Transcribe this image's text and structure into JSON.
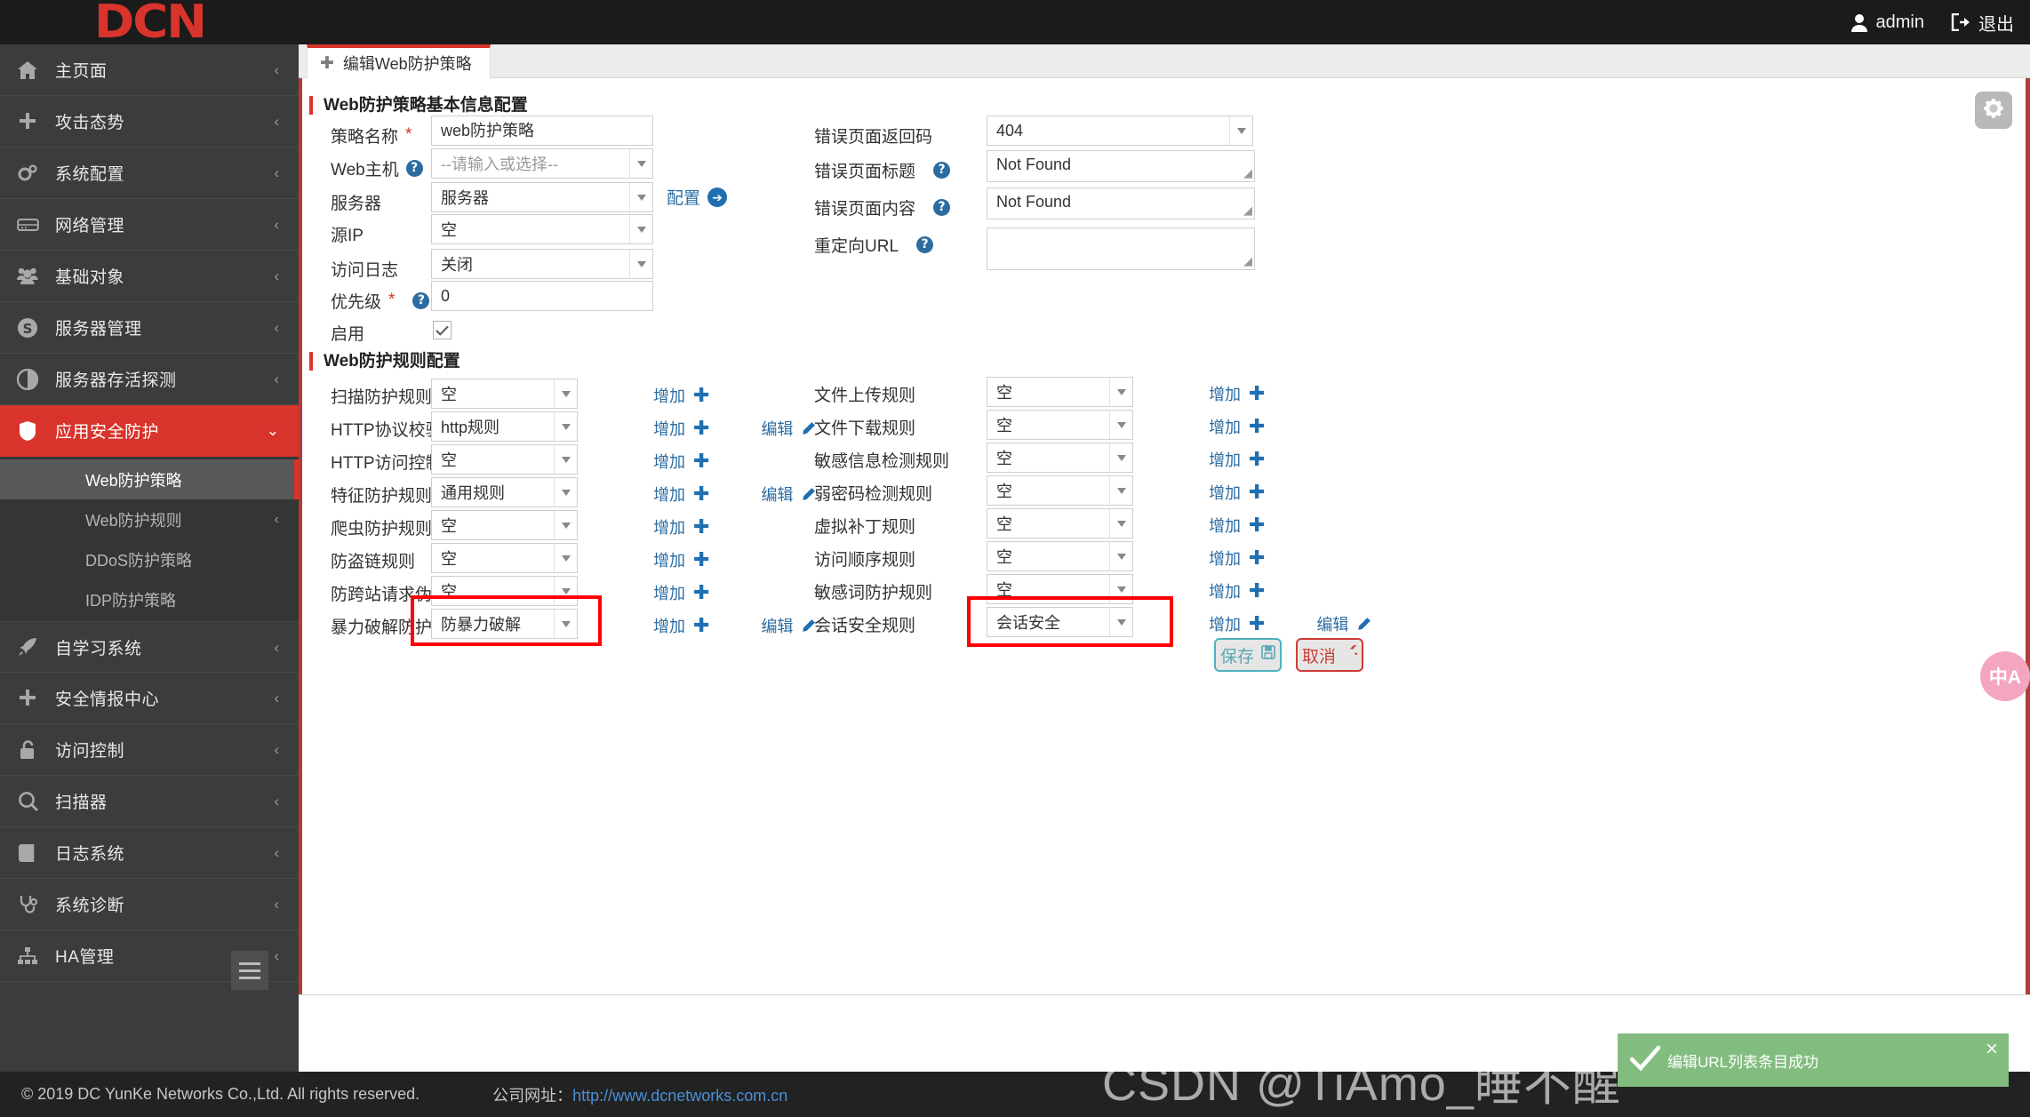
{
  "brand": {
    "logo": "DCN"
  },
  "topbar": {
    "user": "admin",
    "logout": "退出"
  },
  "tab": {
    "label": "编辑Web防护策略"
  },
  "sidebar": {
    "items": [
      {
        "label": "主页面",
        "icon": "home-icon",
        "caret": "‹"
      },
      {
        "label": "攻击态势",
        "icon": "plus-icon",
        "caret": "‹"
      },
      {
        "label": "系统配置",
        "icon": "gears-icon",
        "caret": "‹"
      },
      {
        "label": "网络管理",
        "icon": "server-icon",
        "caret": "‹"
      },
      {
        "label": "基础对象",
        "icon": "users-icon",
        "caret": "‹"
      },
      {
        "label": "服务器管理",
        "icon": "skype-icon",
        "caret": "‹"
      },
      {
        "label": "服务器存活探测",
        "icon": "contrast-icon",
        "caret": "‹"
      },
      {
        "label": "应用安全防护",
        "icon": "shield-icon",
        "caret": "⌄",
        "active": true
      }
    ],
    "submenu": [
      {
        "label": "Web防护策略",
        "active": true
      },
      {
        "label": "Web防护规则",
        "caret": "‹"
      },
      {
        "label": "DDoS防护策略"
      },
      {
        "label": "IDP防护策略"
      }
    ],
    "items_after": [
      {
        "label": "自学习系统",
        "icon": "rocket-icon",
        "caret": "‹"
      },
      {
        "label": "安全情报中心",
        "icon": "plus-icon",
        "caret": "‹"
      },
      {
        "label": "访问控制",
        "icon": "lock-icon",
        "caret": "‹"
      },
      {
        "label": "扫描器",
        "icon": "search-icon",
        "caret": "‹"
      },
      {
        "label": "日志系统",
        "icon": "book-icon",
        "caret": "‹"
      },
      {
        "label": "系统诊断",
        "icon": "stethoscope-icon",
        "caret": "‹"
      },
      {
        "label": "HA管理",
        "icon": "sitemap-icon",
        "caret": "‹"
      }
    ]
  },
  "basic": {
    "title": "Web防护策略基本信息配置",
    "policy_name": {
      "label": "策略名称",
      "required": "*",
      "value": "web防护策略"
    },
    "web_host": {
      "label": "Web主机",
      "help": "?",
      "placeholder": "--请输入或选择--"
    },
    "server": {
      "label": "服务器",
      "value": "服务器",
      "config_link": "配置"
    },
    "source_ip": {
      "label": "源IP",
      "value": "空"
    },
    "access_log": {
      "label": "访问日志",
      "value": "关闭"
    },
    "priority": {
      "label": "优先级",
      "required": "*",
      "help": "?",
      "value": "0"
    },
    "enable": {
      "label": "启用",
      "checked": true
    },
    "err_code": {
      "label": "错误页面返回码",
      "value": "404"
    },
    "err_title": {
      "label": "错误页面标题",
      "help": "?",
      "value": "Not Found"
    },
    "err_body": {
      "label": "错误页面内容",
      "help": "?",
      "value": "Not Found"
    },
    "redirect_url": {
      "label": "重定向URL",
      "help": "?",
      "value": ""
    }
  },
  "rules": {
    "title": "Web防护规则配置",
    "add_label": "增加",
    "edit_label": "编辑",
    "left": [
      {
        "label": "扫描防护规则",
        "value": "空",
        "add": true,
        "edit": false
      },
      {
        "label": "HTTP协议校验规则",
        "value": "http规则",
        "add": true,
        "edit": true
      },
      {
        "label": "HTTP访问控制规则",
        "value": "空",
        "add": true,
        "edit": false
      },
      {
        "label": "特征防护规则",
        "value": "通用规则",
        "add": true,
        "edit": true
      },
      {
        "label": "爬虫防护规则",
        "value": "空",
        "add": true,
        "edit": false
      },
      {
        "label": "防盗链规则",
        "value": "空",
        "add": true,
        "edit": false
      },
      {
        "label": "防跨站请求伪造规则",
        "value": "空",
        "add": true,
        "edit": false
      },
      {
        "label": "暴力破解防护规则",
        "value": "防暴力破解",
        "add": true,
        "edit": true,
        "highlight": true
      }
    ],
    "right": [
      {
        "label": "文件上传规则",
        "value": "空",
        "add": true,
        "edit": false
      },
      {
        "label": "文件下载规则",
        "value": "空",
        "add": true,
        "edit": false
      },
      {
        "label": "敏感信息检测规则",
        "value": "空",
        "add": true,
        "edit": false
      },
      {
        "label": "弱密码检测规则",
        "value": "空",
        "add": true,
        "edit": false
      },
      {
        "label": "虚拟补丁规则",
        "value": "空",
        "add": true,
        "edit": false
      },
      {
        "label": "访问顺序规则",
        "value": "空",
        "add": true,
        "edit": false
      },
      {
        "label": "敏感词防护规则",
        "value": "空",
        "add": true,
        "edit": false
      },
      {
        "label": "会话安全规则",
        "value": "会话安全",
        "add": true,
        "edit": true,
        "highlight": true
      }
    ]
  },
  "buttons": {
    "save": "保存",
    "cancel": "取消"
  },
  "toast": {
    "message": "编辑URL列表条目成功",
    "close": "×"
  },
  "watermark": {
    "text": "CSDN @TiAmo_睡不醒"
  },
  "footer": {
    "copyright": "© 2019 DC YunKe Networks Co.,Ltd. All rights reserved.",
    "site_label": "公司网址：",
    "site_url": "http://www.dcnetworks.com.cn"
  },
  "colors": {
    "brand_red": "#d9342b",
    "link_blue": "#2b6ca3",
    "toast_green": "#82bd7f"
  }
}
